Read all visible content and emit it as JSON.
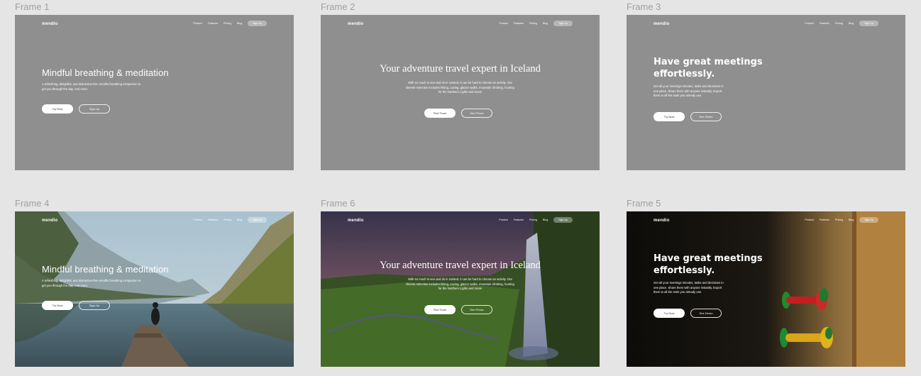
{
  "frames": [
    {
      "label": "Frame 1",
      "logo": "mendio",
      "nav": [
        "Product",
        "Features",
        "Pricing",
        "Blog"
      ],
      "signup": "Sign Up",
      "heading": "Mindful breathing & meditation",
      "body": "A refreshing, delightful, and distraction-free mindful breathing companion to get you through the day. And more.",
      "primary": "Try Now",
      "secondary": "Sign Up"
    },
    {
      "label": "Frame 2",
      "logo": "mendio",
      "nav": [
        "Product",
        "Features",
        "Pricing",
        "Blog"
      ],
      "signup": "Sign Up",
      "heading": "Your adventure travel expert in Iceland",
      "body": "With so much to see and do in Iceland, it can be hard to choose an activity. Our diverse selection includes hiking, caving, glacier walks, mountain climbing, hunting for the Northern Lights and more!",
      "primary": "Find Tours",
      "secondary": "See Prices"
    },
    {
      "label": "Frame 3",
      "logo": "mendio",
      "nav": [
        "Product",
        "Features",
        "Pricing",
        "Blog"
      ],
      "signup": "Sign Up",
      "heading": "Have great meetings effortlessly.",
      "body": "Get all your meetings minutes, tasks and decisions in one place. Share them with anyone instantly. Export them to all the tools you already use.",
      "primary": "Try Now",
      "secondary": "See Demo"
    },
    {
      "label": "Frame 4",
      "logo": "mendio",
      "nav": [
        "Product",
        "Features",
        "Pricing",
        "Blog"
      ],
      "signup": "Sign Up",
      "heading": "Mindful breathing & meditation",
      "body": "A refreshing, delightful, and distraction-free mindful breathing companion to get you through the day. And more.",
      "primary": "Try Now",
      "secondary": "Sign Up"
    },
    {
      "label": "Frame 6",
      "logo": "mendio",
      "nav": [
        "Product",
        "Features",
        "Pricing",
        "Blog"
      ],
      "signup": "Sign Up",
      "heading": "Your adventure travel expert in Iceland",
      "body": "With so much to see and do in Iceland, it can be hard to choose an activity. Our diverse selection includes hiking, caving, glacier walks, mountain climbing, hunting for the Northern Lights and more!",
      "primary": "Find Tours",
      "secondary": "See Prices"
    },
    {
      "label": "Frame 5",
      "logo": "mendio",
      "nav": [
        "Product",
        "Features",
        "Pricing",
        "Blog"
      ],
      "signup": "Sign Up",
      "heading": "Have great meetings effortlessly.",
      "body": "Get all your meetings minutes, tasks and decisions in one place. Share them with anyone instantly. Export them to all the tools you already use.",
      "primary": "Try Now",
      "secondary": "See Demo"
    }
  ],
  "colors": {
    "canvas": "#e5e5e5",
    "placeholder": "#8f8f8f",
    "label": "#a0a0a0"
  }
}
